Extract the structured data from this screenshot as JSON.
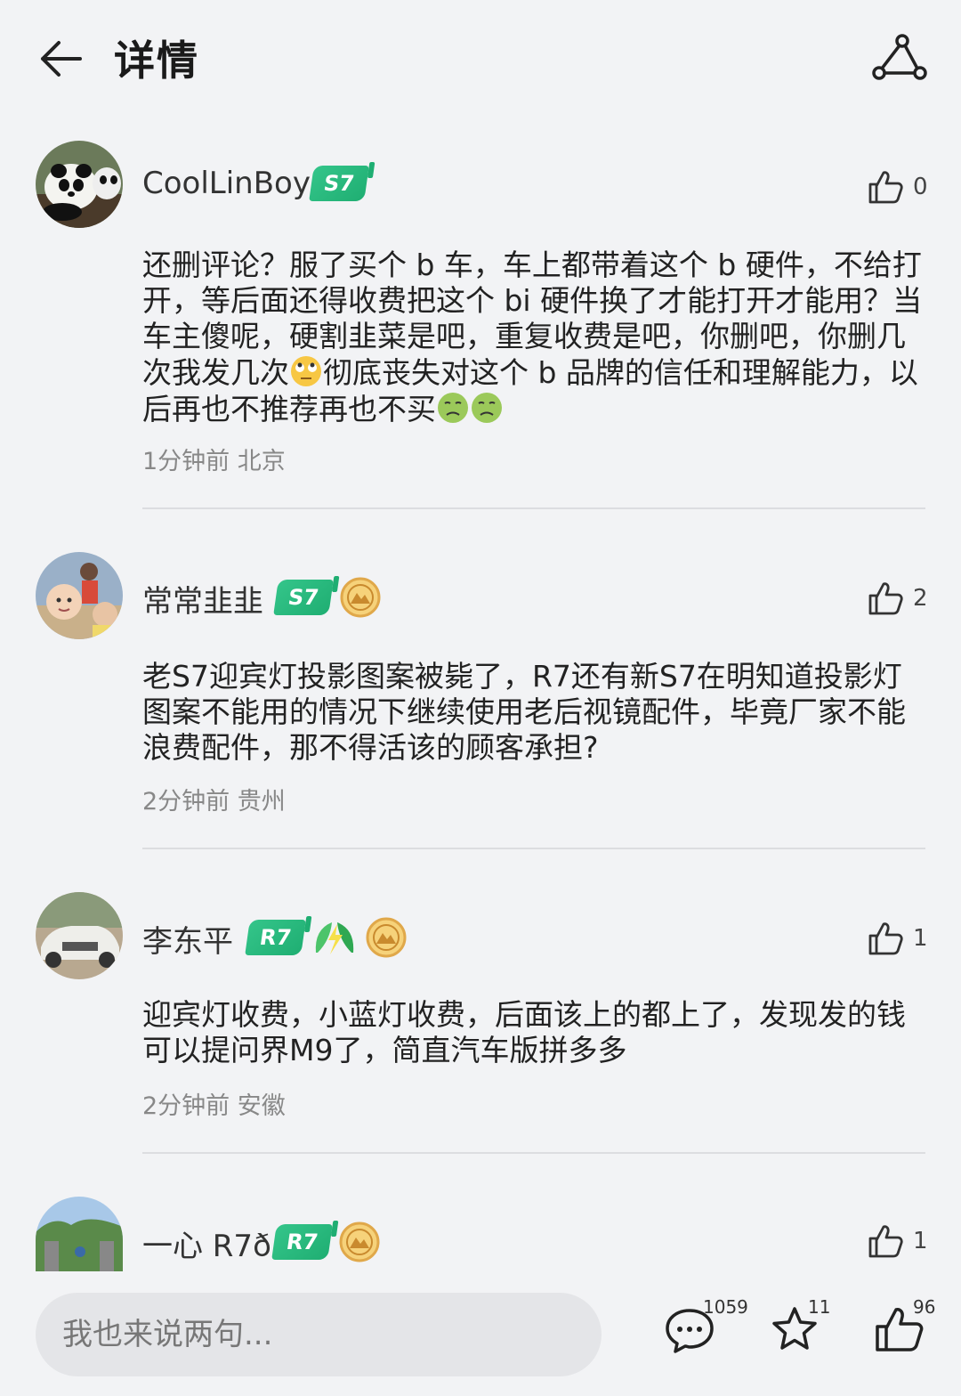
{
  "header": {
    "title": "详情"
  },
  "comments": [
    {
      "username": "CoolLinBoy",
      "car_badge": "S7",
      "likes": "0",
      "text": "还删评论？服了买个 b 车，车上都带着这个 b 硬件，不给打开，等后面还得收费把这个 bi 硬件换了才能打开才能用？当车主傻呢，硬割韭菜是吧，重复收费是吧，你删吧，你删几次我发几次",
      "text_2": "彻底丧失对这个 b 品牌的信任和理解能力，以后再也不推荐再也不买",
      "time": "1分钟前",
      "location": "北京"
    },
    {
      "username": "常常韭韭",
      "car_badge": "S7",
      "likes": "2",
      "text": "老S7迎宾灯投影图案被毙了，R7还有新S7在明知道投影灯图案不能用的情况下继续使用老后视镜配件，毕竟厂家不能浪费配件，那不得活该的顾客承担?",
      "time": "2分钟前",
      "location": "贵州"
    },
    {
      "username": "李东平",
      "car_badge": "R7",
      "likes": "1",
      "text": "迎宾灯收费，小蓝灯收费，后面该上的都上了，发现发的钱可以提问界M9了，简直汽车版拼多多",
      "time": "2分钟前",
      "location": "安徽"
    },
    {
      "username": "一心 R7ð",
      "car_badge": "R7",
      "likes": "1"
    }
  ],
  "bottom_bar": {
    "input_placeholder": "我也来说两句...",
    "comment_count": "1059",
    "favorite_count": "11",
    "like_count": "96"
  },
  "colors": {
    "background": "#f2f3f5",
    "badge_green": "#25b77b",
    "medal_gold": "#e5b35a"
  }
}
